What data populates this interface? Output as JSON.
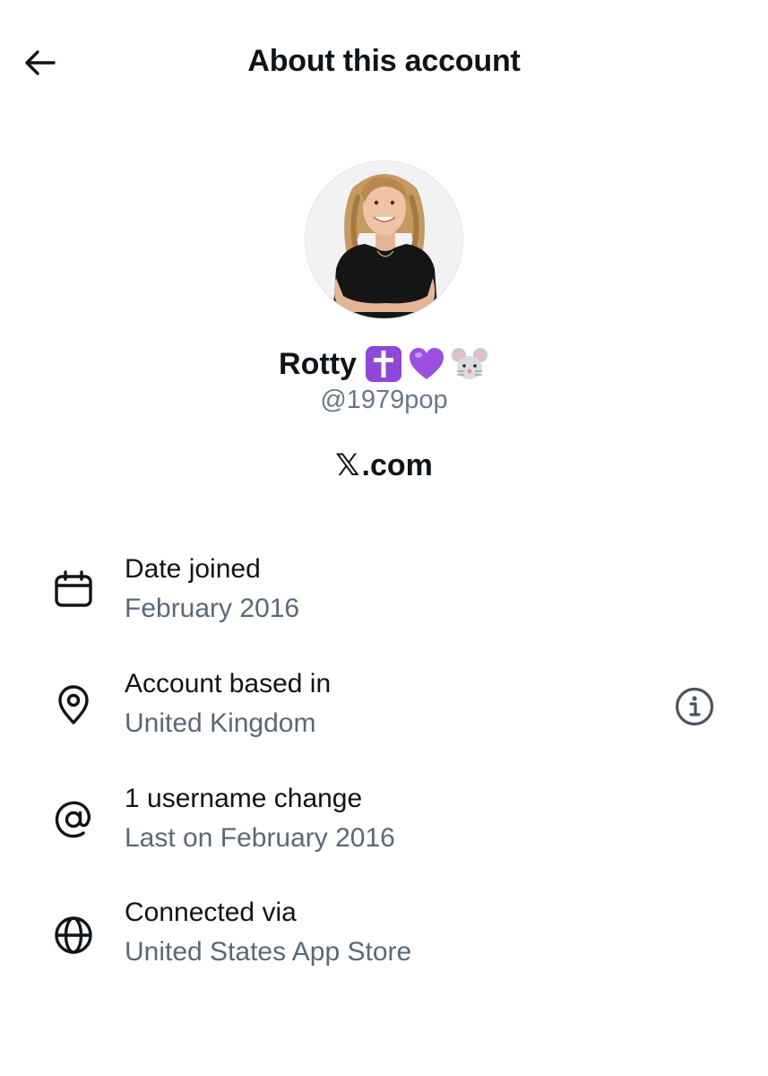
{
  "header": {
    "title": "About this account",
    "back_icon": "arrow-left-icon"
  },
  "profile": {
    "display_name": "Rotty",
    "badges": [
      "latin-cross-emoji",
      "purple-heart-emoji",
      "mouse-face-emoji"
    ],
    "handle": "@1979pop"
  },
  "brand": {
    "x_glyph": "𝕏",
    "text": ".com"
  },
  "details": [
    {
      "icon": "calendar-icon",
      "label": "Date joined",
      "value": "February 2016"
    },
    {
      "icon": "location-pin-icon",
      "label": "Account based in",
      "value": "United Kingdom",
      "info_icon": "info-icon"
    },
    {
      "icon": "at-sign-icon",
      "label": "1 username change",
      "value": "Last on February 2016"
    },
    {
      "icon": "globe-icon",
      "label": "Connected via",
      "value": "United States App Store"
    }
  ],
  "colors": {
    "text_primary": "#0f1419",
    "text_secondary": "#5b6875",
    "handle": "#6b7785",
    "purple": "#8e47d6"
  }
}
